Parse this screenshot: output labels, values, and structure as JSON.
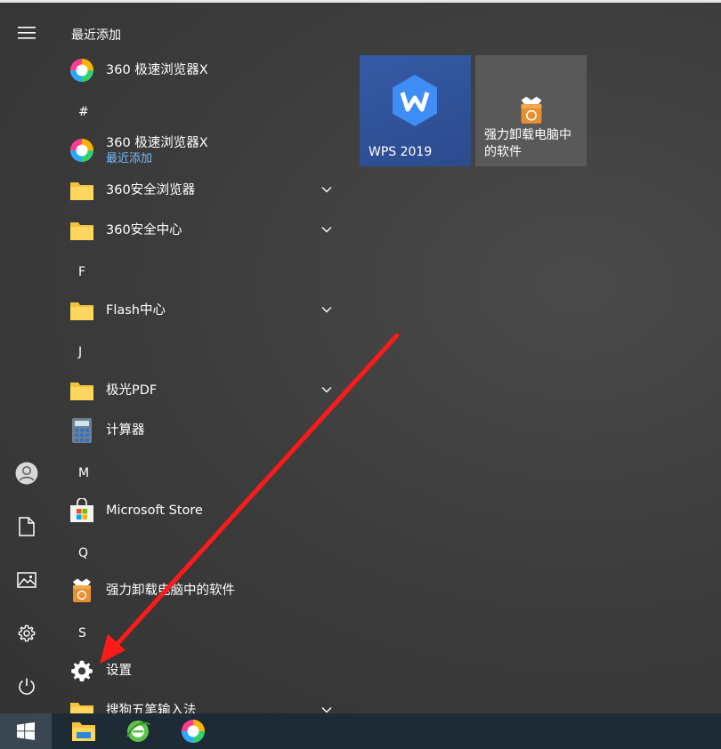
{
  "colors": {
    "accent_link": "#78b9ff",
    "tile_wps": "#2f529a",
    "tile_uninstaller": "#595959",
    "taskbar": "#1e2a34",
    "annotation_arrow": "#ff1a1a"
  },
  "rail": {
    "items": [
      {
        "name": "menu",
        "icon": "hamburger-icon"
      },
      {
        "name": "account",
        "icon": "user-icon"
      },
      {
        "name": "documents",
        "icon": "document-icon"
      },
      {
        "name": "pictures",
        "icon": "picture-icon"
      },
      {
        "name": "settings",
        "icon": "gear-icon"
      },
      {
        "name": "power",
        "icon": "power-icon"
      }
    ]
  },
  "app_list": {
    "recent_header": "最近添加",
    "recent_app": {
      "name": "360 极速浏览器X",
      "icon": "browser-360-icon"
    },
    "letters": {
      "hash": "#",
      "f": "F",
      "j": "J",
      "m": "M",
      "q": "Q",
      "s": "S"
    },
    "apps": {
      "browser_x": {
        "name": "360 极速浏览器X",
        "sub": "最近添加",
        "icon": "browser-360-icon"
      },
      "safe_browser": {
        "name": "360安全浏览器",
        "icon": "folder-icon"
      },
      "safe_center": {
        "name": "360安全中心",
        "icon": "folder-icon"
      },
      "flash": {
        "name": "Flash中心",
        "icon": "folder-icon"
      },
      "pdf": {
        "name": "极光PDF",
        "icon": "folder-icon"
      },
      "calculator": {
        "name": "计算器",
        "icon": "calculator-icon"
      },
      "store": {
        "name": "Microsoft Store",
        "icon": "store-icon"
      },
      "uninstaller": {
        "name": "强力卸载电脑中的软件",
        "icon": "recycle-box-icon"
      },
      "settings": {
        "name": "设置",
        "icon": "gear-icon"
      },
      "sogou": {
        "name": "搜狗五笔输入法",
        "icon": "folder-icon"
      }
    }
  },
  "tiles": {
    "wps": {
      "label": "WPS 2019",
      "icon": "wps-icon"
    },
    "uninstaller": {
      "label_line1": "强力卸载电脑中",
      "label_line2": "的软件",
      "icon": "recycle-box-icon"
    }
  },
  "taskbar": {
    "items": [
      {
        "name": "start",
        "icon": "windows-icon"
      },
      {
        "name": "file-explorer",
        "icon": "file-explorer-icon"
      },
      {
        "name": "ie-360-browser",
        "icon": "browser-green-e-icon"
      },
      {
        "name": "360-browser",
        "icon": "browser-360-icon"
      }
    ]
  }
}
